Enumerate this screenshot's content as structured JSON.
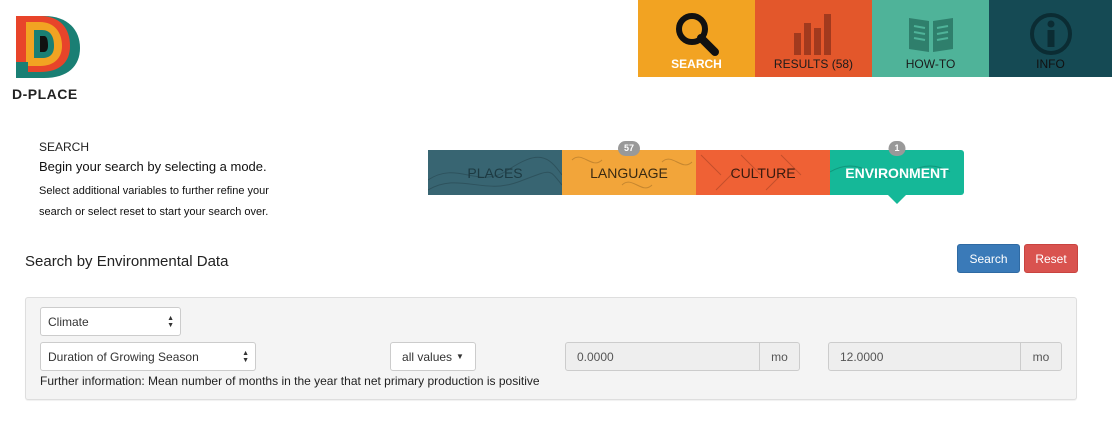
{
  "brand": {
    "name": "D-PLACE"
  },
  "topnav": [
    {
      "label": "SEARCH",
      "icon": "search-icon",
      "color": "#f2a322"
    },
    {
      "label": "RESULTS (58)",
      "icon": "bar-chart-icon",
      "color": "#e3572b"
    },
    {
      "label": "HOW-TO",
      "icon": "book-icon",
      "color": "#4fb399"
    },
    {
      "label": "INFO",
      "icon": "info-icon",
      "color": "#154a54"
    }
  ],
  "intro": {
    "heading": "SEARCH",
    "lead": "Begin your search by selecting a mode.",
    "sub": "Select additional variables to further refine your search or select reset to start your search over."
  },
  "modes": [
    {
      "label": "PLACES",
      "badge": null,
      "color": "#386572"
    },
    {
      "label": "LANGUAGE",
      "badge": "57",
      "color": "#f2a53a"
    },
    {
      "label": "CULTURE",
      "badge": null,
      "color": "#ef6135"
    },
    {
      "label": "ENVIRONMENT",
      "badge": "1",
      "active": true,
      "color": "#15b898"
    }
  ],
  "section": {
    "title": "Search by Environmental Data",
    "search_label": "Search",
    "reset_label": "Reset"
  },
  "filter": {
    "category": "Climate",
    "variable": "Duration of Growing Season",
    "operator": "all values",
    "min_value": "0.0000",
    "min_unit": "mo",
    "max_value": "12.0000",
    "max_unit": "mo",
    "further_info": "Further information: Mean number of months in the year that net primary production is positive"
  }
}
